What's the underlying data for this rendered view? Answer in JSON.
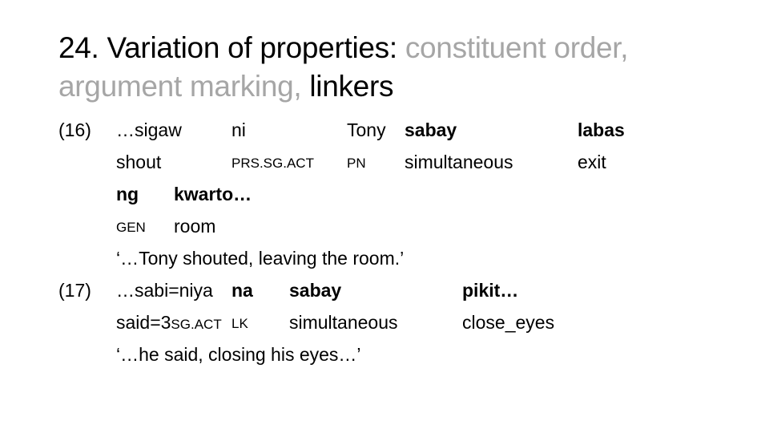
{
  "slide": {
    "title": {
      "part1": "24. Variation of properties: ",
      "part2": "constituent order,",
      "part3": "argument marking, ",
      "part4": "linkers"
    },
    "colors": {
      "text": "#000000",
      "muted": "#a6a6a6"
    },
    "examples": [
      {
        "number": "(16)",
        "words": [
          {
            "form": "…sigaw",
            "gloss": "shout"
          },
          {
            "form": "ni",
            "gloss": "PRS.SG.ACT"
          },
          {
            "form": "Tony",
            "gloss": "PN"
          },
          {
            "form": "sabay",
            "gloss": "simultaneous"
          },
          {
            "form": "labas",
            "gloss": "exit"
          },
          {
            "form": "ng",
            "gloss": "GEN"
          },
          {
            "form": "kwarto…",
            "gloss": "room"
          }
        ],
        "translation": "‘…Tony shouted, leaving the room.’"
      },
      {
        "number": "(17)",
        "words": [
          {
            "form": "…sabi=niya",
            "gloss": "said=3",
            "gloss_sc": "SG.ACT"
          },
          {
            "form": "na",
            "gloss": "LK"
          },
          {
            "form": "sabay",
            "gloss": "simultaneous"
          },
          {
            "form": "pikit…",
            "gloss": "close_eyes"
          }
        ],
        "translation": "‘…he said, closing his eyes…’"
      }
    ]
  }
}
